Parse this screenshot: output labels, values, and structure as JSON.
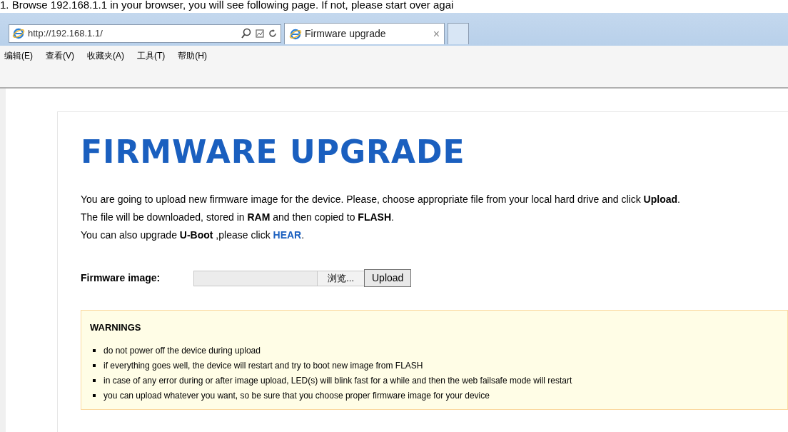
{
  "caption": "1. Browse 192.168.1.1 in your browser, you will see following page. If not, please start over agai",
  "browser": {
    "address": "http://192.168.1.1/",
    "tabs": [
      {
        "title": "Firmware upgrade",
        "close": "×",
        "selected": true
      }
    ],
    "menu": [
      "编辑(E)",
      "查看(V)",
      "收藏夹(A)",
      "工具(T)",
      "帮助(H)"
    ]
  },
  "page": {
    "heading": "FIRMWARE UPGRADE",
    "paragraphs": [
      {
        "text": "You are going to upload new firmware image for the device. Please, choose appropriate file from your local hard drive and click **Upload**."
      },
      {
        "text": "The file will be downloaded, stored in **RAM** and then copied to **FLASH**."
      },
      {
        "text": "You can also upgrade **U-Boot** ,please click",
        "link": "HEAR",
        "after": "."
      }
    ],
    "form": {
      "label": "Firmware image:",
      "browse_button": "浏览...",
      "upload_button": "Upload"
    },
    "warnings": {
      "title": "WARNINGS",
      "items": [
        "do not power off the device during upload",
        "if everything goes well, the device will restart and try to boot new image from FLASH",
        "in case of any error during or after image upload, LED(s) will blink fast for a while and then the web failsafe mode will restart",
        "you can upload whatever you want, so be sure that you choose proper firmware image for your device"
      ]
    }
  }
}
